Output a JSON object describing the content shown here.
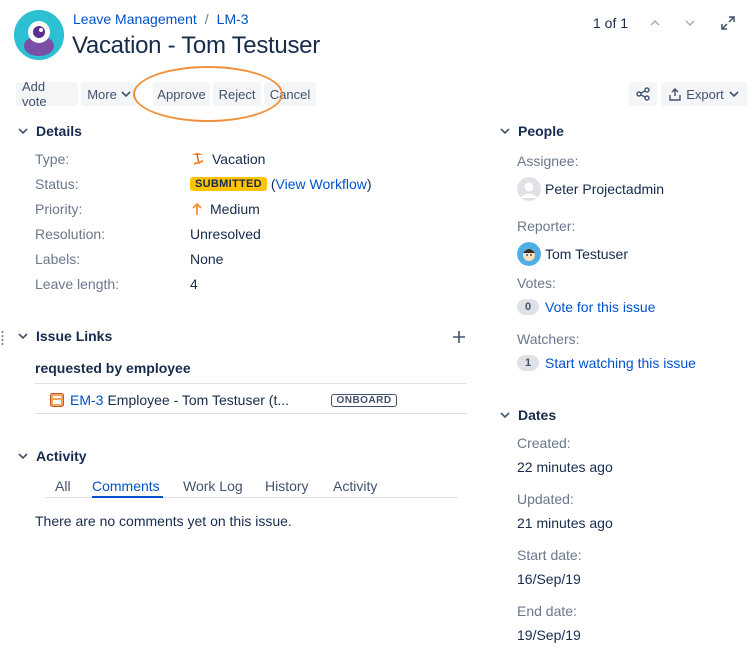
{
  "breadcrumb": {
    "project": "Leave Management",
    "separator": "/",
    "issue_key": "LM-3"
  },
  "title": "Vacation - Tom Testuser",
  "pager": {
    "text": "1 of 1"
  },
  "toolbar": {
    "add_vote": "Add vote",
    "more": "More",
    "approve": "Approve",
    "reject": "Reject",
    "cancel": "Cancel",
    "export": "Export",
    "accent_annotation_color": "#f0913b"
  },
  "details": {
    "heading": "Details",
    "fields": {
      "type_label": "Type:",
      "type_value": "Vacation",
      "status_label": "Status:",
      "status_value": "SUBMITTED",
      "status_paren_open": "(",
      "status_link": "View Workflow",
      "status_paren_close": ")",
      "priority_label": "Priority:",
      "priority_value": "Medium",
      "resolution_label": "Resolution:",
      "resolution_value": "Unresolved",
      "labels_label": "Labels:",
      "labels_value": "None",
      "leave_length_label": "Leave length:",
      "leave_length_value": "4"
    }
  },
  "issue_links": {
    "heading": "Issue Links",
    "group_label": "requested by employee",
    "link_key": "EM-3",
    "link_summary": "Employee - Tom Testuser (t...",
    "link_status": "ONBOARD"
  },
  "activity": {
    "heading": "Activity",
    "tabs": [
      "All",
      "Comments",
      "Work Log",
      "History",
      "Activity"
    ],
    "active_tab": "Comments",
    "empty_text": "There are no comments yet on this issue."
  },
  "people": {
    "heading": "People",
    "assignee_label": "Assignee:",
    "assignee_name": "Peter Projectadmin",
    "reporter_label": "Reporter:",
    "reporter_name": "Tom Testuser",
    "votes_label": "Votes:",
    "votes_count": "0",
    "votes_link": "Vote for this issue",
    "watchers_label": "Watchers:",
    "watchers_count": "1",
    "watchers_link": "Start watching this issue"
  },
  "dates": {
    "heading": "Dates",
    "created_label": "Created:",
    "created_value": "22 minutes ago",
    "updated_label": "Updated:",
    "updated_value": "21 minutes ago",
    "start_label": "Start date:",
    "start_value": "16/Sep/19",
    "end_label": "End date:",
    "end_value": "19/Sep/19"
  }
}
